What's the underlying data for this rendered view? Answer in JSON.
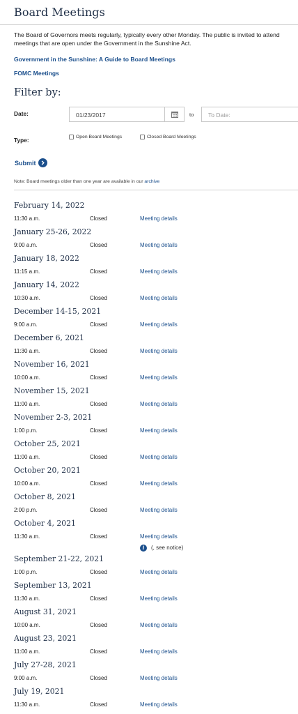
{
  "header": {
    "title": "Board Meetings"
  },
  "intro": "The Board of Governors meets regularly, typically every other Monday. The public is invited to attend meetings that are open under the Government in the Sunshine Act.",
  "links": {
    "sunshine": "Government in the Sunshine: A Guide to Board Meetings",
    "fomc": "FOMC Meetings"
  },
  "filter": {
    "title": "Filter by:",
    "date_label": "Date:",
    "date_from_value": "01/23/2017",
    "to_label": "to",
    "date_to_placeholder": "To Date:",
    "type_label": "Type:",
    "type_options": [
      "Open Board Meetings",
      "Closed Board Meetings"
    ],
    "submit_label": "Submit"
  },
  "note": {
    "text": "Note: Board meetings older than one year are available in our ",
    "link": "archive"
  },
  "meetings": [
    {
      "date": "February 14, 2022",
      "time": "11:30 a.m.",
      "status": "Closed",
      "link": "Meeting details"
    },
    {
      "date": "January 25-26, 2022",
      "time": "9:00 a.m.",
      "status": "Closed",
      "link": "Meeting details"
    },
    {
      "date": "January 18, 2022",
      "time": "11:15 a.m.",
      "status": "Closed",
      "link": "Meeting details"
    },
    {
      "date": "January 14, 2022",
      "time": "10:30 a.m.",
      "status": "Closed",
      "link": "Meeting details"
    },
    {
      "date": "December 14-15, 2021",
      "time": "9:00 a.m.",
      "status": "Closed",
      "link": "Meeting details"
    },
    {
      "date": "December 6, 2021",
      "time": "11:30 a.m.",
      "status": "Closed",
      "link": "Meeting details"
    },
    {
      "date": "November 16, 2021",
      "time": "10:00 a.m.",
      "status": "Closed",
      "link": "Meeting details"
    },
    {
      "date": "November 15, 2021",
      "time": "11:00 a.m.",
      "status": "Closed",
      "link": "Meeting details"
    },
    {
      "date": "November 2-3, 2021",
      "time": "1:00 p.m.",
      "status": "Closed",
      "link": "Meeting details"
    },
    {
      "date": "October 25, 2021",
      "time": "11:00 a.m.",
      "status": "Closed",
      "link": "Meeting details"
    },
    {
      "date": "October 20, 2021",
      "time": "10:00 a.m.",
      "status": "Closed",
      "link": "Meeting details"
    },
    {
      "date": "October 8, 2021",
      "time": "2:00 p.m.",
      "status": "Closed",
      "link": "Meeting details"
    },
    {
      "date": "October 4, 2021",
      "time": "11:30 a.m.",
      "status": "Closed",
      "link": "Meeting details",
      "notice": "(, see notice)"
    },
    {
      "date": "September 21-22, 2021",
      "time": "1:00 p.m.",
      "status": "Closed",
      "link": "Meeting details"
    },
    {
      "date": "September 13, 2021",
      "time": "11:30 a.m.",
      "status": "Closed",
      "link": "Meeting details"
    },
    {
      "date": "August 31, 2021",
      "time": "10:00 a.m.",
      "status": "Closed",
      "link": "Meeting details"
    },
    {
      "date": "August 23, 2021",
      "time": "11:00 a.m.",
      "status": "Closed",
      "link": "Meeting details"
    },
    {
      "date": "July 27-28, 2021",
      "time": "9:00 a.m.",
      "status": "Closed",
      "link": "Meeting details"
    },
    {
      "date": "July 19, 2021",
      "time": "11:30 a.m.",
      "status": "Closed",
      "link": "Meeting details"
    }
  ],
  "colors": {
    "accent": "#1b4f8c",
    "heading": "#1f2f47"
  },
  "icons": {
    "calendar": "calendar-icon",
    "submit": "chevron-right-icon",
    "info": "info-icon"
  }
}
